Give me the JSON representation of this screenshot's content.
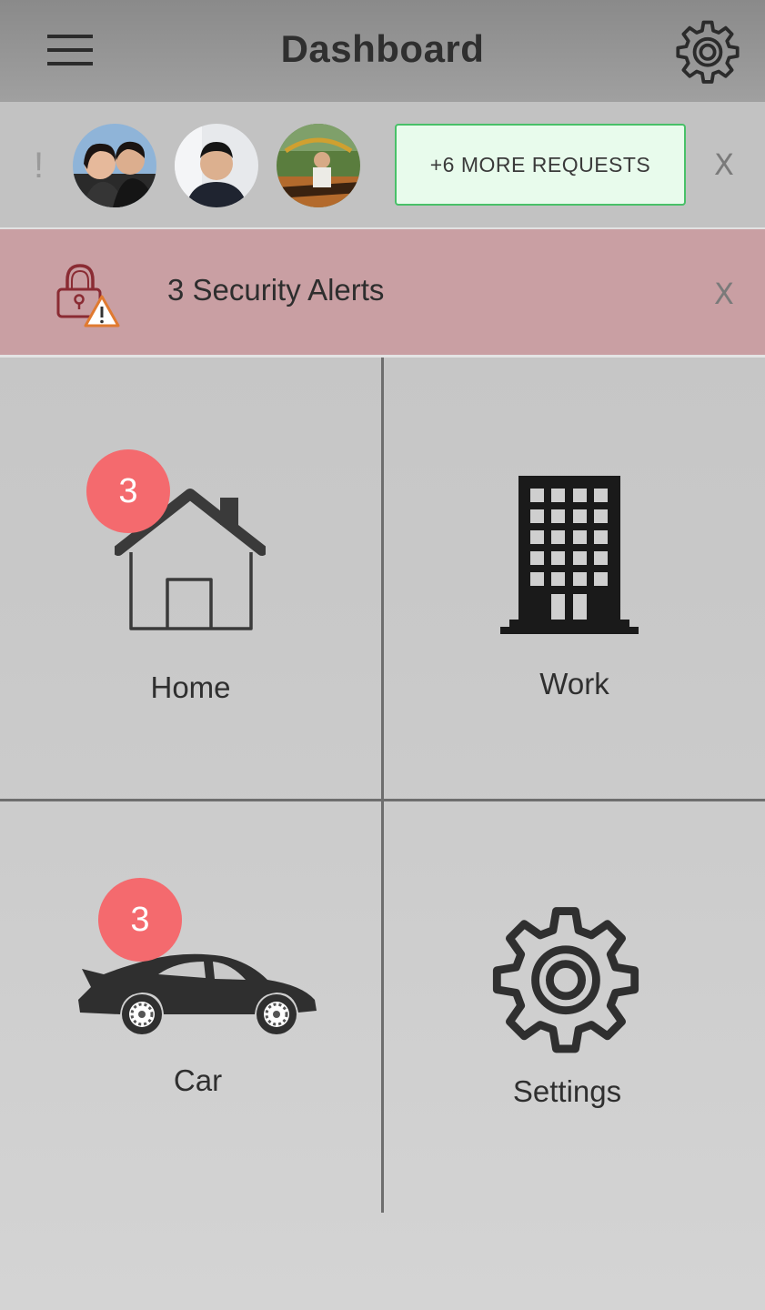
{
  "header": {
    "title": "Dashboard",
    "menu_icon": "hamburger-menu-icon",
    "settings_icon": "gear-icon"
  },
  "requests": {
    "indicator": "!",
    "avatars": [
      {
        "icon": "avatar-photo"
      },
      {
        "icon": "avatar-photo"
      },
      {
        "icon": "avatar-photo"
      }
    ],
    "more_label": "+6 MORE REQUESTS",
    "close_label": "X"
  },
  "alert": {
    "icon": "lock-warning-icon",
    "text": "3 Security Alerts",
    "close_label": "X",
    "color": "#c99fa3"
  },
  "tiles": {
    "home": {
      "label": "Home",
      "badge": "3",
      "icon": "house-icon"
    },
    "work": {
      "label": "Work",
      "icon": "building-icon"
    },
    "car": {
      "label": "Car",
      "badge": "3",
      "icon": "car-icon"
    },
    "settings": {
      "label": "Settings",
      "icon": "gear-icon"
    }
  },
  "colors": {
    "badge": "#f46a6e",
    "more_button_border": "#48c068",
    "more_button_bg": "#e8fbec"
  }
}
